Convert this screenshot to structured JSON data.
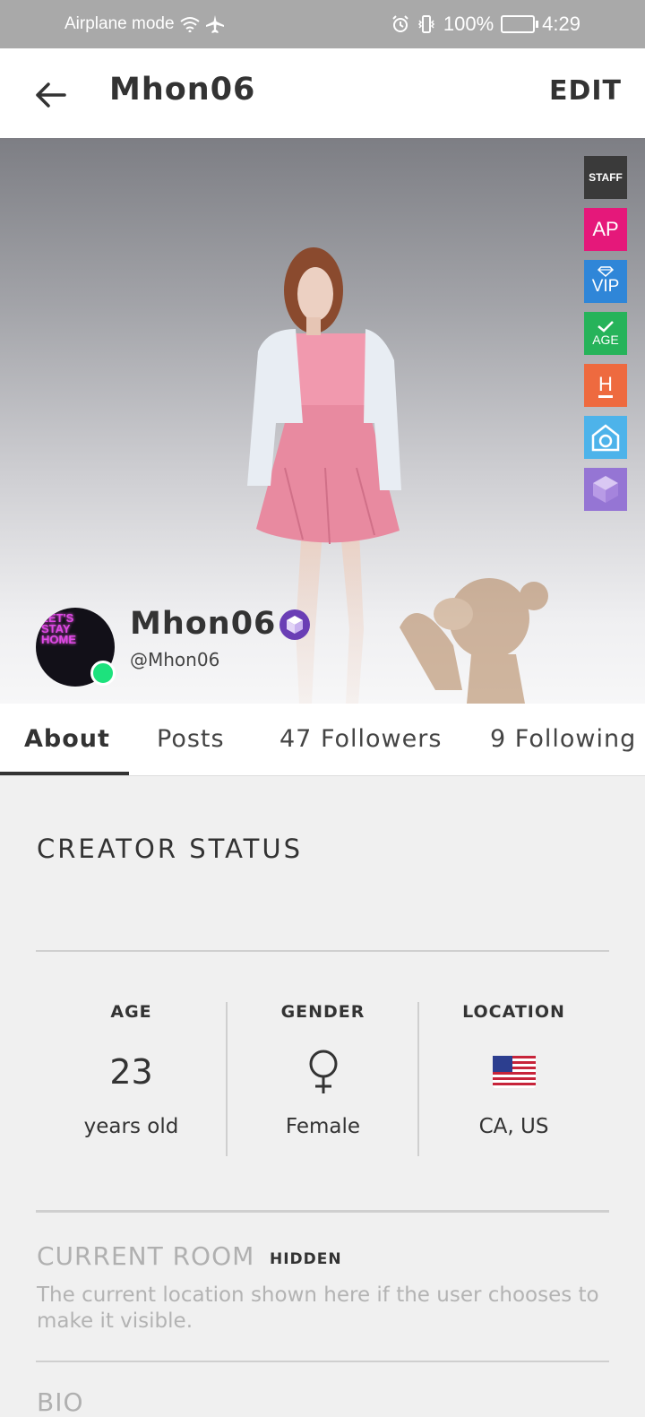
{
  "status_bar": {
    "airplane_text": "Airplane mode",
    "battery": "100%",
    "time": "4:29",
    "icons": [
      "wifi-icon",
      "airplane-icon",
      "alarm-icon",
      "vibrate-icon",
      "battery-icon"
    ]
  },
  "header": {
    "title": "Mhon06",
    "edit_label": "EDIT",
    "back_icon": "arrow-left-icon"
  },
  "badges": [
    {
      "name": "staff",
      "label": "STAFF"
    },
    {
      "name": "ap",
      "label": "AP"
    },
    {
      "name": "vip",
      "label": "VIP"
    },
    {
      "name": "age",
      "label": "AGE"
    },
    {
      "name": "host",
      "label": "H"
    },
    {
      "name": "home",
      "label": ""
    },
    {
      "name": "creator",
      "label": ""
    }
  ],
  "profile": {
    "name": "Mhon06",
    "handle": "@Mhon06",
    "avatar_text": "LET'S STAY HOME",
    "online": true
  },
  "tabs": [
    "About",
    "Posts",
    "47 Followers",
    "9 Following"
  ],
  "about": {
    "creator_status_title": "CREATOR STATUS",
    "age": {
      "label": "AGE",
      "value": "23",
      "sub": "years old"
    },
    "gender": {
      "label": "GENDER",
      "value": "♀",
      "sub": "Female"
    },
    "location": {
      "label": "LOCATION",
      "sub": "CA, US",
      "icon": "us-flag-icon"
    },
    "current_room": {
      "title": "CURRENT ROOM",
      "tag": "HIDDEN",
      "description": "The current location shown here if the user chooses to make it visible."
    },
    "bio_title": "BIO"
  },
  "colors": {
    "staff": "#3a3a3a",
    "ap": "#e5187a",
    "vip": "#2f86d8",
    "age": "#26b35a",
    "host": "#ee6a3f",
    "home": "#4db3ea",
    "creator": "#9575d4",
    "online": "#1de27d"
  }
}
